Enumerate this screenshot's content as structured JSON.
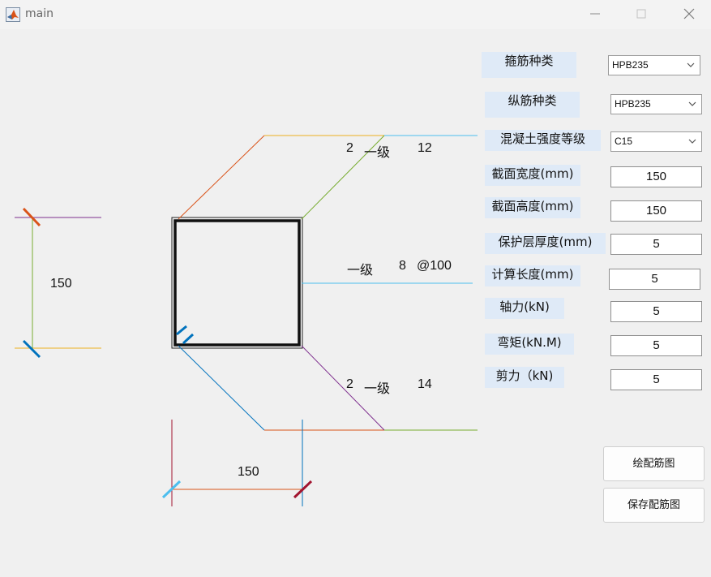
{
  "window": {
    "title": "main",
    "icon": "matlab-icon",
    "controls": [
      "minimize-icon",
      "maximize-icon",
      "close-icon"
    ]
  },
  "drawing": {
    "section_width_dim": "150",
    "section_height_dim": "150",
    "top_bar": {
      "count": "2",
      "grade": "一级",
      "diameter": "12"
    },
    "stirrup": {
      "grade": "一级",
      "diameter": "8",
      "spacing": "@100"
    },
    "bottom_bar": {
      "count": "2",
      "grade": "一级",
      "diameter": "14"
    },
    "colors": {
      "orange": "#d95319",
      "yellow": "#edb120",
      "purple": "#7e2f8e",
      "green": "#77ac30",
      "light_blue": "#4dbeee",
      "blue": "#0072bd",
      "dark_red": "#a2142f"
    }
  },
  "form": {
    "stirrup_type": {
      "label": "箍筋种类",
      "value": "HPB235"
    },
    "long_bar_type": {
      "label": "纵筋种类",
      "value": "HPB235"
    },
    "concrete_grade": {
      "label": "混凝土强度等级",
      "value": "C15"
    },
    "section_width": {
      "label": "截面宽度(mm)",
      "value": "150"
    },
    "section_height": {
      "label": "截面高度(mm)",
      "value": "150"
    },
    "cover_thickness": {
      "label": "保护层厚度(mm)",
      "value": "5"
    },
    "calc_length": {
      "label": "计算长度(mm)",
      "value": "5"
    },
    "axial_force": {
      "label": "轴力(kN)",
      "value": "5"
    },
    "moment": {
      "label": "弯矩(kN.M)",
      "value": "5"
    },
    "shear": {
      "label": "剪力（kN)",
      "value": "5"
    }
  },
  "buttons": {
    "draw": "绘配筋图",
    "save": "保存配筋图"
  }
}
